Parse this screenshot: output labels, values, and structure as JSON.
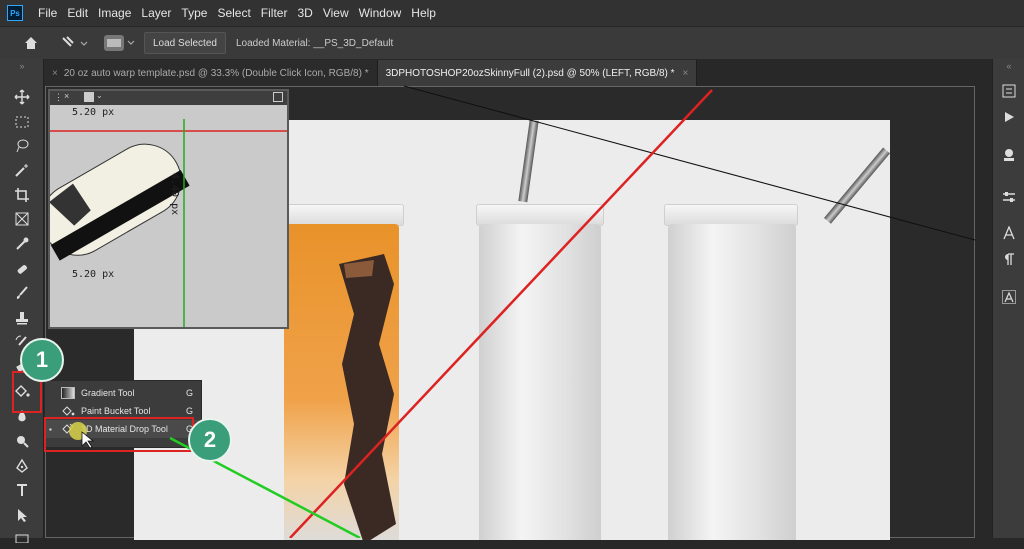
{
  "app": {
    "logo_text": "Ps"
  },
  "menubar": {
    "items": [
      "File",
      "Edit",
      "Image",
      "Layer",
      "Type",
      "Select",
      "Filter",
      "3D",
      "View",
      "Window",
      "Help"
    ]
  },
  "options": {
    "load_selected": "Load Selected",
    "loaded_material": "Loaded Material: __PS_3D_Default"
  },
  "tabs": [
    {
      "label": "20 oz auto warp template.psd @ 33.3% (Double Click Icon, RGB/8) *",
      "close": "×",
      "active": false
    },
    {
      "label": "3DPHOTOSHOP20ozSkinnyFull (2).psd @ 50% (LEFT, RGB/8) *",
      "close": "×",
      "active": true
    }
  ],
  "preview": {
    "top_measure": "5.20 px",
    "side_measure": "4.40 px",
    "bottom_measure": "5.20 px"
  },
  "flyout": [
    {
      "label": "Gradient Tool",
      "key": "G"
    },
    {
      "label": "Paint Bucket Tool",
      "key": "G"
    },
    {
      "label": "3D Material Drop Tool",
      "key": "G",
      "active": true
    }
  ],
  "badges": [
    "1",
    "2"
  ],
  "colors": {
    "accent_red": "#dd2222",
    "badge_green": "#3a9e7a",
    "guide_green": "#22cc22"
  }
}
